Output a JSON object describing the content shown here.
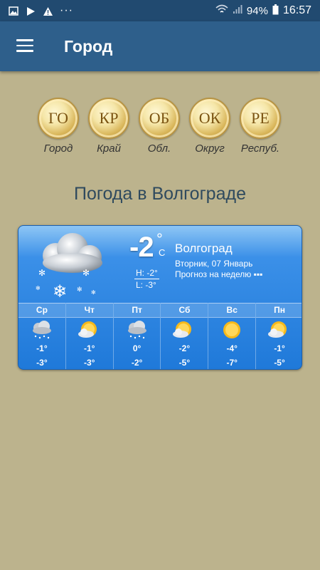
{
  "status_bar": {
    "battery": "94%",
    "time": "16:57",
    "left_icons": [
      "image-icon",
      "play-store-icon",
      "warning-icon",
      "more-icon"
    ],
    "right_icons": [
      "wifi-icon",
      "signal-icon",
      "battery-icon"
    ]
  },
  "app_bar": {
    "title": "Город",
    "menu_icon": "hamburger-menu-icon"
  },
  "coins": [
    {
      "abbr": "ГО",
      "label": "Город"
    },
    {
      "abbr": "КР",
      "label": "Край"
    },
    {
      "abbr": "ОБ",
      "label": "Обл."
    },
    {
      "abbr": "ОК",
      "label": "Округ"
    },
    {
      "abbr": "РЕ",
      "label": "Респуб."
    }
  ],
  "headline": "Погода в Волгограде",
  "widget": {
    "temp": "-2",
    "degree": "°",
    "unit": "C",
    "high": "H: -2°",
    "low": "L: -3°",
    "city": "Волгоград",
    "date": "Вторник, 07 Январь",
    "forecast_link": "Прогноз на неделю ▪▪▪",
    "days": [
      {
        "name": "Ср",
        "icon": "snow-cloud-icon",
        "hi": "-1°",
        "lo": "-3°"
      },
      {
        "name": "Чт",
        "icon": "sun-cloud-icon",
        "hi": "-1°",
        "lo": "-3°"
      },
      {
        "name": "Пт",
        "icon": "snow-cloud-icon",
        "hi": "0°",
        "lo": "-2°"
      },
      {
        "name": "Сб",
        "icon": "sun-cloud-icon",
        "hi": "-2°",
        "lo": "-5°"
      },
      {
        "name": "Вс",
        "icon": "sun-icon",
        "hi": "-4°",
        "lo": "-7°"
      },
      {
        "name": "Пн",
        "icon": "sun-cloud-icon",
        "hi": "-1°",
        "lo": "-5°"
      }
    ]
  },
  "colors": {
    "background": "#bcb38d",
    "status_bar": "#214a70",
    "app_bar": "#2e5f8b",
    "widget_blue": "#1f79d9"
  }
}
